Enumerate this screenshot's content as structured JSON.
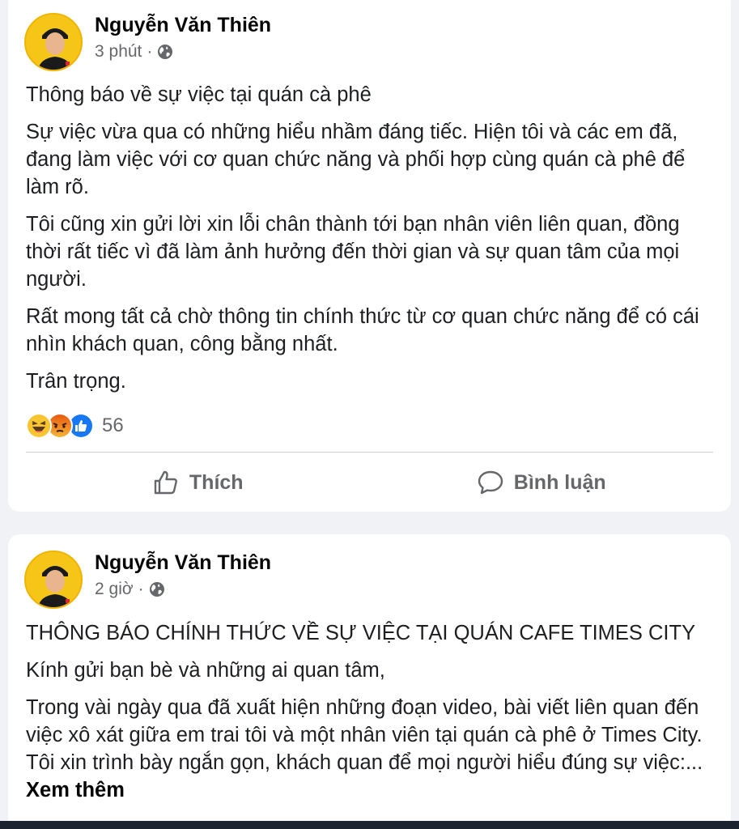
{
  "posts": [
    {
      "author": "Nguyễn Văn Thiên",
      "time": "3 phút",
      "separator": "·",
      "privacy_icon": "globe-icon",
      "paragraphs": [
        "Thông báo về sự việc tại quán cà phê",
        "Sự việc vừa qua có những hiểu nhầm đáng tiếc. Hiện tôi và các em đã, đang làm việc với cơ quan chức năng và phối hợp cùng quán cà phê để làm rõ.",
        "Tôi cũng xin gửi lời xin lỗi chân thành tới bạn nhân viên liên quan, đồng thời rất tiếc vì đã làm ảnh hưởng đến thời gian và sự quan tâm của mọi người.",
        "Rất mong tất cả chờ thông tin chính thức từ cơ quan chức năng để có cái nhìn khách quan, công bằng nhất.",
        "Trân trọng."
      ],
      "reactions": {
        "icons": [
          "haha-icon",
          "angry-icon",
          "like-icon"
        ],
        "count": "56"
      },
      "actions": {
        "like_label": "Thích",
        "comment_label": "Bình luận"
      }
    },
    {
      "author": "Nguyễn Văn Thiên",
      "time": "2 giờ",
      "separator": "·",
      "privacy_icon": "globe-icon",
      "paragraphs": [
        "THÔNG BÁO CHÍNH THỨC VỀ SỰ VIỆC TẠI QUÁN CAFE TIMES CITY",
        "Kính gửi bạn bè và những ai quan tâm,",
        "Trong vài ngày qua đã xuất hiện những đoạn video, bài viết liên quan đến việc xô xát giữa em trai tôi và một nhân viên tại quán cà phê ở Times City. Tôi xin trình bày ngắn gọn, khách quan để mọi người hiểu đúng sự việc:..."
      ],
      "see_more": "Xem thêm"
    }
  ],
  "colors": {
    "page_bg": "#f0f2f5",
    "card_bg": "#ffffff",
    "secondary_text": "#65676b",
    "like_blue": "#1877f2",
    "angry_orange": "#e9710f"
  }
}
